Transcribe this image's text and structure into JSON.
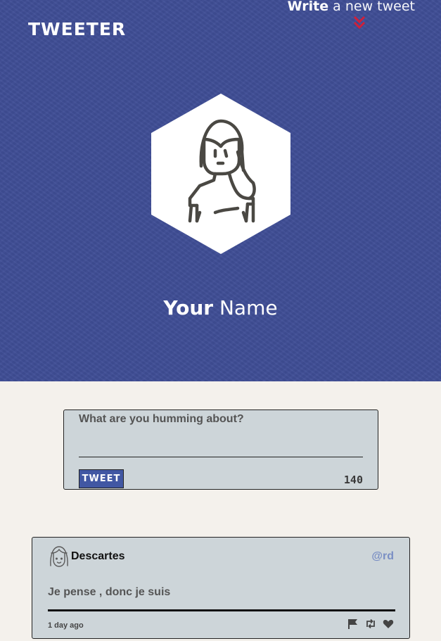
{
  "header": {
    "brand": "TWEETER",
    "compose_strong": "Write",
    "compose_light": " a new tweet",
    "compose_icon": "double-chevron-down-icon",
    "profile_icon": "user-avatar-icon",
    "name_bold": "Your",
    "name_light": " Name"
  },
  "composer": {
    "placeholder": "What are you humming about?",
    "value": "",
    "button_label": "TWEET",
    "counter": "140"
  },
  "tweets": [
    {
      "avatar_icon": "user-avatar-icon",
      "name": "Descartes",
      "handle": "@rd",
      "text": "Je pense , donc je suis",
      "time": "1 day ago",
      "actions": [
        "flag-icon",
        "retweet-icon",
        "heart-icon"
      ]
    }
  ],
  "colors": {
    "hero_bg": "#3f4e96",
    "page_bg": "#f4f1ec",
    "card_bg": "#cdd5d9",
    "accent": "#4157a3",
    "chevron": "#d0203a",
    "handle": "#7a8fc4"
  }
}
